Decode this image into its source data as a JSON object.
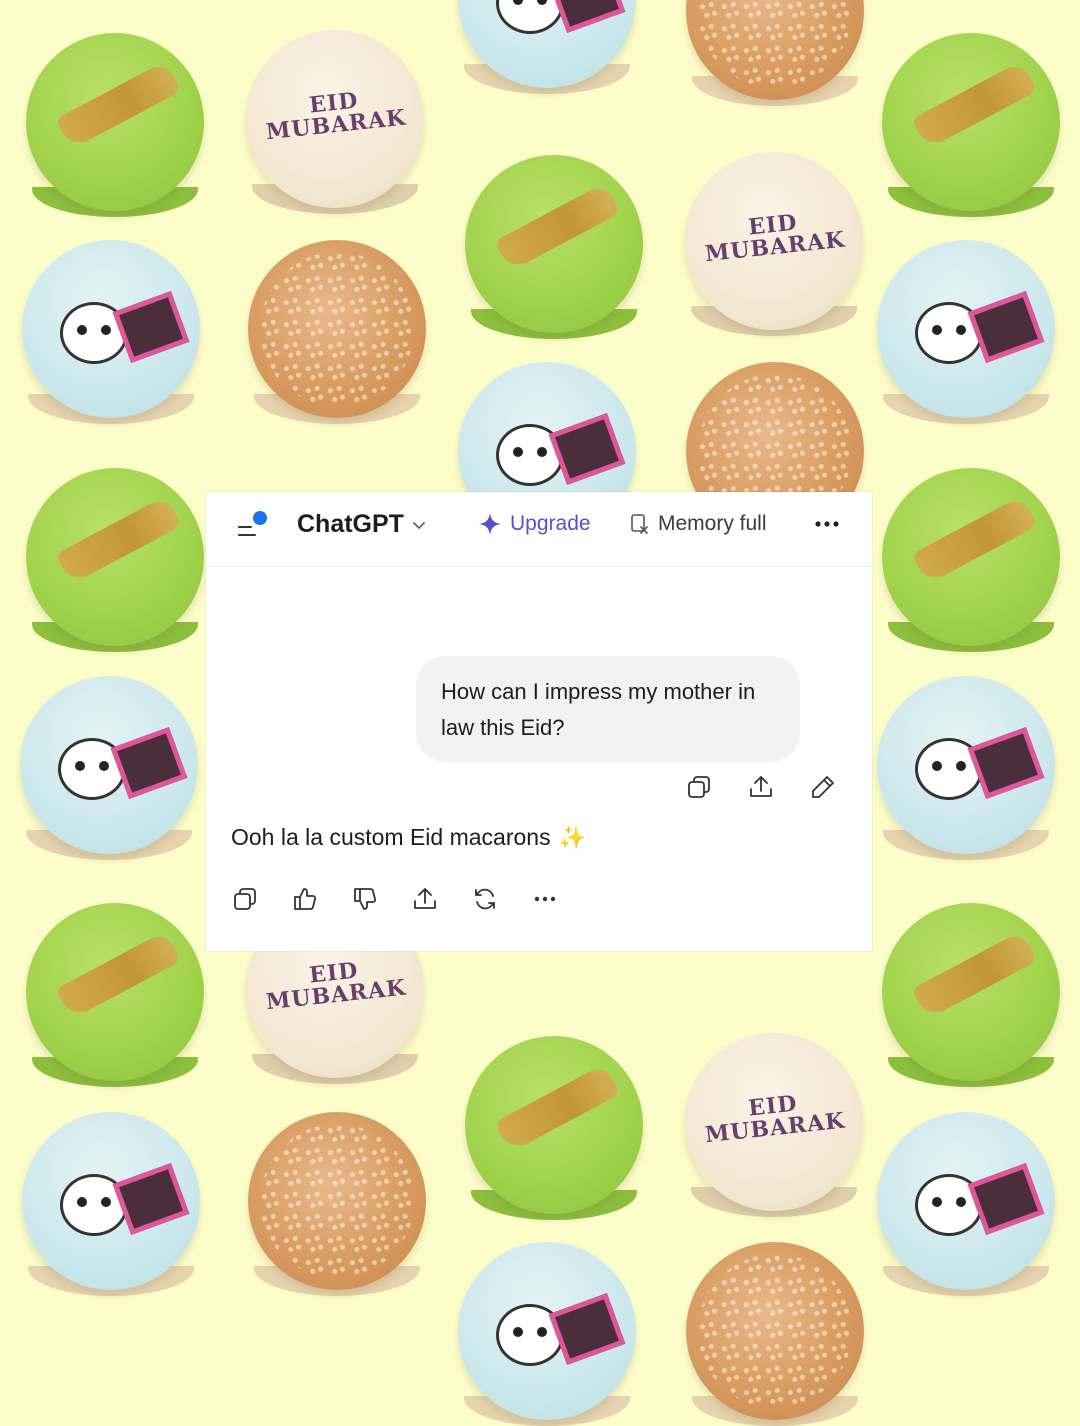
{
  "colors": {
    "background": "#fdfdc9",
    "accent_upgrade": "#5b4fcf",
    "notification_dot": "#1a73e8",
    "bubble_bg": "#f2f2f2"
  },
  "background_macarons": {
    "eid_text_line1": "EID",
    "eid_text_line2": "MUBARAK"
  },
  "header": {
    "menu_icon": "sidebar-menu-icon",
    "model_name": "ChatGPT",
    "upgrade_label": "Upgrade",
    "memory_label": "Memory full",
    "more_icon": "more-horizontal-icon"
  },
  "conversation": {
    "user_message": "How can I impress my mother in law this Eid?",
    "user_actions": [
      "copy-icon",
      "share-icon",
      "edit-icon"
    ],
    "assistant_message": "Ooh la la custom Eid macarons",
    "assistant_emoji": "✨",
    "assistant_actions": [
      "copy-icon",
      "thumbs-up-icon",
      "thumbs-down-icon",
      "share-icon",
      "regenerate-icon",
      "more-horizontal-icon"
    ]
  }
}
